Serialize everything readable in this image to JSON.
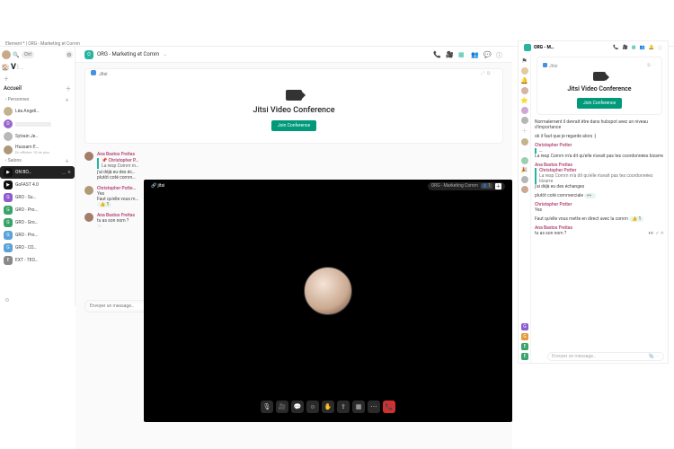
{
  "window": {
    "title": "Element * | ORG - Marketing et Comm"
  },
  "sidebar": {
    "brand": "V",
    "search_modifier": "Ctrl",
    "home": "Accueil",
    "people_label": "Personnes",
    "rooms_label": "Salons",
    "people": [
      {
        "name": "Léa Angeli…",
        "avatar_color": "#c4b28e"
      },
      {
        "name": "D",
        "avatar_color": "#9966cc",
        "muted": true
      },
      {
        "name": "Sylvain Je…",
        "avatar_color": "#b8b8b8"
      },
      {
        "name": "Hussam E…",
        "sub": "En afficher 10 de plus",
        "avatar_color": "#ad987a"
      }
    ],
    "rooms": [
      {
        "letter": "▶",
        "name": "ON BO…",
        "color": "#111",
        "selected": true,
        "extra": "+"
      },
      {
        "letter": "▶",
        "name": "GoFAST 4.0",
        "color": "#111"
      },
      {
        "letter": "G",
        "name": "GRO - Su…",
        "color": "#8e5bd1"
      },
      {
        "letter": "G",
        "name": "GRO - Pro…",
        "color": "#3aa36a"
      },
      {
        "letter": "G",
        "name": "GRO - Gro…",
        "color": "#3aa36a"
      },
      {
        "letter": "G",
        "name": "GRO - Pro…",
        "color": "#5aa2d8"
      },
      {
        "letter": "G",
        "name": "GRO - CO…",
        "color": "#5aa2d8"
      },
      {
        "letter": "E",
        "name": "EXT - TEO…",
        "color": "#888"
      }
    ]
  },
  "header": {
    "room_letter": "O",
    "room_color": "#28b5a0",
    "title": "ORG - Marketing et Comm",
    "icons": [
      "phone",
      "video",
      "grid",
      "people",
      "chat",
      "info"
    ]
  },
  "jitsi_card": {
    "app": "Jitsi",
    "title": "Jitsi Video Conference",
    "join": "Join Conference"
  },
  "messages": [
    {
      "who": "Ana Bastos Freitas",
      "avatar": "#a47c68",
      "quote_who": "Christopher P…",
      "quote": "La resp Comm m…",
      "lines": [
        "j'ai déjà eu des éc…",
        "plutôt coté comm…"
      ]
    },
    {
      "who": "Christopher Potte…",
      "avatar": "#b09a78",
      "lines": [
        "Yes",
        "Faut qu'elle vous m…"
      ],
      "reaction": "👍 1"
    },
    {
      "who": "Ana Bastos Freitas",
      "avatar": "#a47c68",
      "meta": "11",
      "lines": [
        "tu as son nom ?"
      ]
    }
  ],
  "composer": {
    "placeholder": "Envoyer un message…"
  },
  "call": {
    "brand": "jitsi",
    "room": "ORG - Marketing Comm",
    "participants": "1",
    "controls": [
      "mic",
      "cam",
      "chat",
      "smile",
      "hand",
      "share",
      "grid",
      "more",
      "hangup"
    ]
  },
  "mini": {
    "title": "ORG - M…",
    "jitsi": {
      "label": "Jitsi",
      "title": "Jitsi Video Conference",
      "join": "Join Conference"
    },
    "chat": [
      {
        "line": "Normalement il devrait être dans hubspot avec un niveau d'importance"
      },
      {
        "line": "ok il faut que je regarde alors :)"
      },
      {
        "who": "Christopher Potter",
        "quote_who": "…",
        "line": "La resp Comm m'a dit qu'elle n'avait pas tes coordonnées bizarre"
      },
      {
        "who": "Ana Bastos Freitas",
        "quote_who": "Christopher Potter",
        "quote": "La resp Comm m'a dit qu'elle n'avait pas tes coordonnées bizarre",
        "line": "j'ai déjà eu des échanges"
      },
      {
        "line": "plutôt coté commerciale",
        "react": "👀"
      },
      {
        "who": "Christopher Potter",
        "line": "Yes"
      },
      {
        "line": "Faut qu'elle vous mette en direct avec la comm",
        "react": "👍 1"
      },
      {
        "who": "Ana Bastos Freitas",
        "line": "tu as son nom ?",
        "meta": "👀 ✔ ❄"
      }
    ],
    "placeholder": "Envoyer un message…",
    "vstrip_letters": [
      "G",
      "G",
      "E",
      "E"
    ]
  }
}
